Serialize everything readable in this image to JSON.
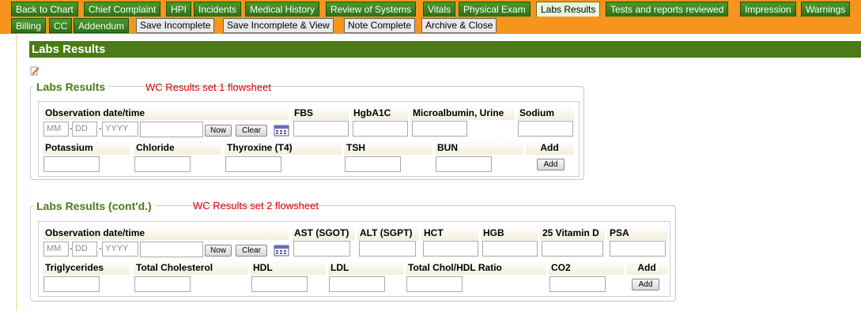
{
  "tabs": [
    "Back to Chart",
    "Chief Complaint",
    "HPI",
    "Incidents",
    "Medical History",
    "Review of Systems",
    "Vitals",
    "Physical Exam",
    "Labs Results",
    "Tests and reports reviewed",
    "Impression",
    "Warnings"
  ],
  "tabs2": [
    "Billing",
    "CC",
    "Addendum"
  ],
  "actions": [
    "Save Incomplete",
    "Save Incomplete & View",
    "Note Complete",
    "Archive & Close"
  ],
  "page_title": "Labs Results",
  "section1": {
    "title": "Labs Results",
    "note": "WC Results set 1 flowsheet",
    "row1_labels": [
      "Observation date/time",
      "FBS",
      "HgbA1C",
      "Microalbumin, Urine",
      "Sodium"
    ],
    "row2_labels": [
      "Potassium",
      "Chloride",
      "Thyroxine (T4)",
      "TSH",
      "BUN",
      "Add"
    ]
  },
  "section2": {
    "title": "Labs Results (cont'd.)",
    "note": "WC Results set 2 flowsheet",
    "row1_labels": [
      "Observation date/time",
      "AST (SGOT)",
      "ALT (SGPT)",
      "HCT",
      "HGB",
      "25 Vitamin D",
      "PSA"
    ],
    "row2_labels": [
      "Triglycerides",
      "Total Cholesterol",
      "HDL",
      "LDL",
      "Total Chol/HDL Ratio",
      "CO2",
      "Add"
    ]
  },
  "date_placeholders": {
    "month": "MM",
    "day": "DD",
    "year": "YYYY"
  },
  "buttons": {
    "now": "Now",
    "clear": "Clear",
    "add": "Add"
  }
}
